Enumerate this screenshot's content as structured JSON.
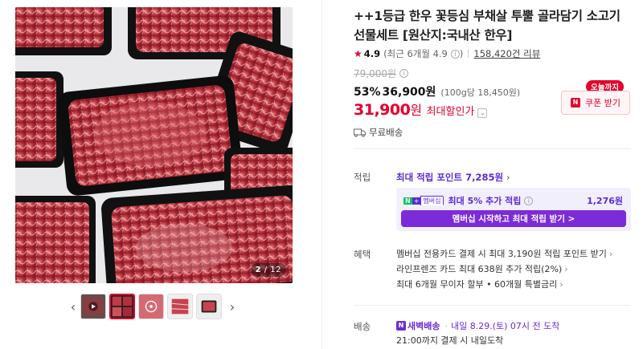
{
  "gallery": {
    "page_current": "2",
    "page_total": "/ 12"
  },
  "thumbnails": [
    {
      "name": "thumb-video",
      "active": false
    },
    {
      "name": "thumb-meat-boxes",
      "active": true
    },
    {
      "name": "thumb-loading",
      "active": false
    },
    {
      "name": "thumb-marbled-meat",
      "active": false
    },
    {
      "name": "thumb-sliced-meat",
      "active": false
    }
  ],
  "product": {
    "title": "++1등급 한우 꽃등심 부채살 투뿔 골라담기 소고기 선물세트 [원산지:국내산 한우]",
    "rating": "4.9",
    "rating_note": "(최근 6개월 4.9",
    "review_count": "158,420건 리뷰",
    "original_price": "79,000원",
    "discount_pct": "53%",
    "sale_price": "36,900원",
    "unit_price": "(100g당 18,450원)",
    "max_discount_price": "31,900",
    "max_discount_unit": "원",
    "max_discount_label": "최대할인가",
    "shipping": "무료배송"
  },
  "coupon": {
    "badge": "오늘까지",
    "button": "쿠폰 받기"
  },
  "points": {
    "label": "적립",
    "max_points": "최대 적립 포인트 7,285원",
    "member_text": "최대 5% 추가 적립",
    "member_amount": "1,276원",
    "member_cta": "멤버십 시작하고 최대 적립 받기 >",
    "np_badge": "멤버십"
  },
  "benefits": {
    "label": "혜택",
    "items": [
      "멤버십 전용카드 결제 시 최대 3,190원 적립 포인트 받기",
      "라인프렌즈 카드 최대 638원 추가 적립(2%)",
      "최대 6개월 무이자 할부 • 60개월 특별금리"
    ]
  },
  "delivery": {
    "label": "배송",
    "badge": "새벽배송",
    "date": "내일 8.29.(토) 07시 전 도착",
    "sub": "21:00까지 결제 시 내일도착"
  }
}
